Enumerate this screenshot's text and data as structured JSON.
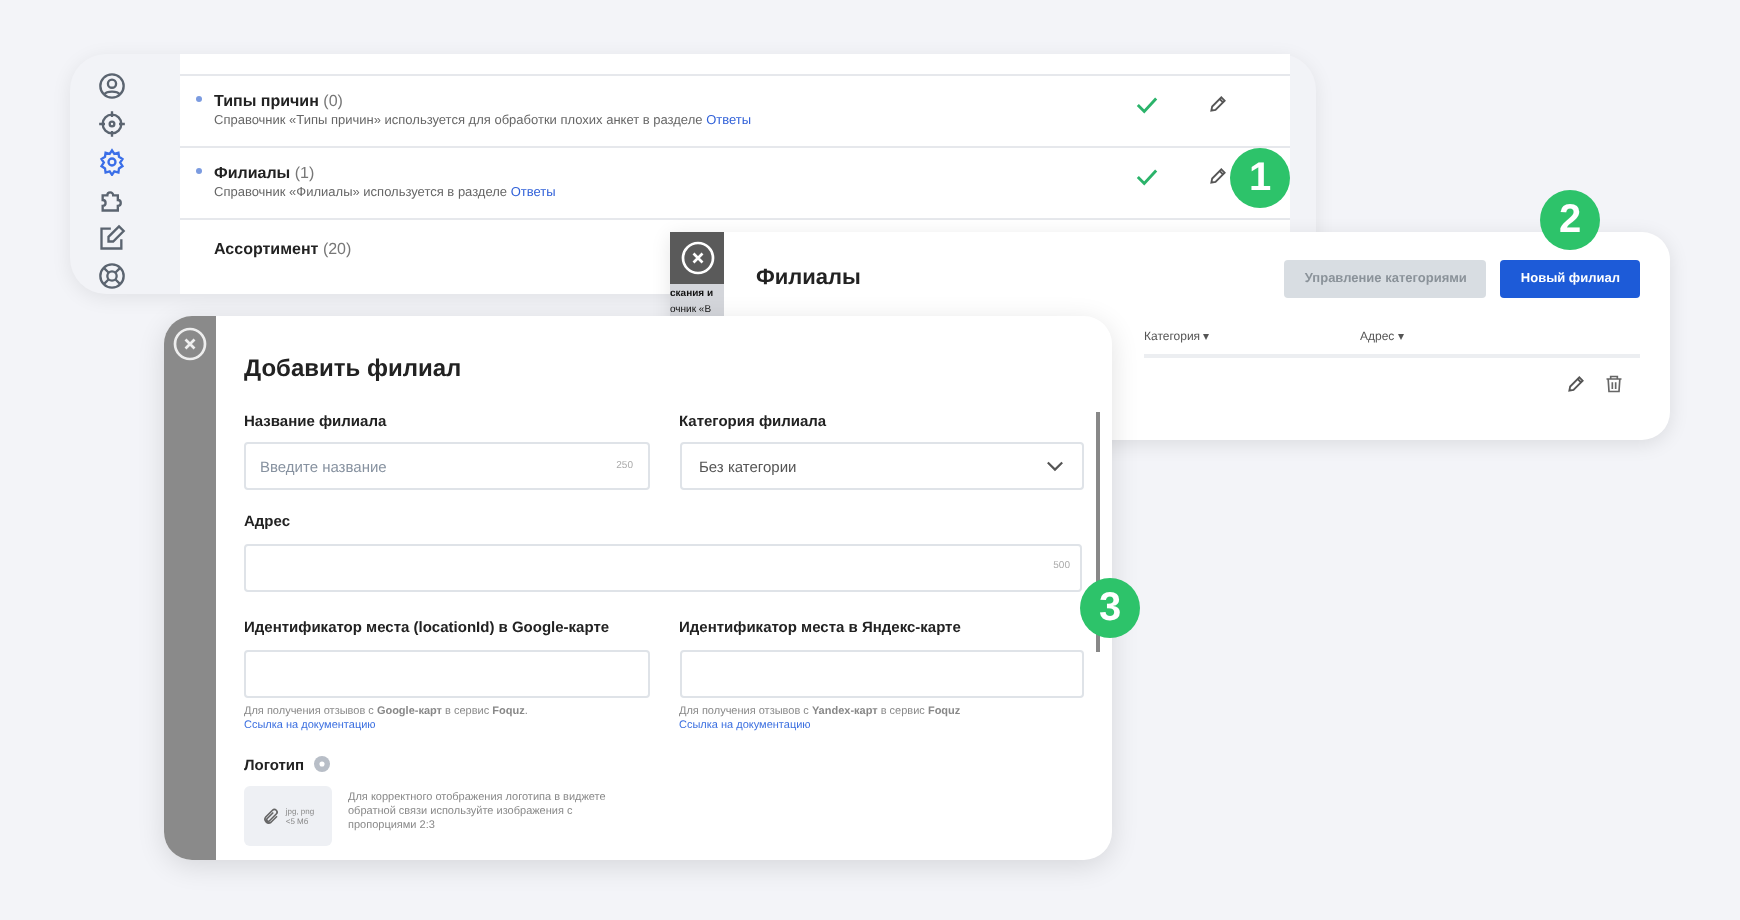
{
  "settings_panel": {
    "sidebar": [
      {
        "kind": "user",
        "selected": false
      },
      {
        "kind": "target",
        "selected": false
      },
      {
        "kind": "gear",
        "selected": true
      },
      {
        "kind": "puzzle",
        "selected": false
      },
      {
        "kind": "edit",
        "selected": false
      },
      {
        "kind": "help",
        "selected": false
      }
    ],
    "dictionaries": [
      {
        "title": "Типы причин",
        "count": "(0)",
        "description": "Справочник «Типы причин» используется для обработки плохих анкет в разделе",
        "link": "Ответы",
        "enabled": true
      },
      {
        "title": "Филиалы",
        "count": "(1)",
        "description": "Справочник «Филиалы» используется в разделе",
        "link": "Ответы",
        "enabled": true
      },
      {
        "title": "Ассортимент",
        "count": "(20)"
      }
    ]
  },
  "steps": [
    "1",
    "2",
    "3"
  ],
  "branches_panel": {
    "side_fragments": [
      "скания и",
      "очник «В"
    ],
    "title": "Филиалы",
    "buttons": [
      {
        "label": "Управление категориями",
        "disabled": true
      },
      {
        "label": "Новый филиал",
        "disabled": false
      }
    ],
    "columns": [
      "Категория ▾",
      "Адрес ▾"
    ]
  },
  "add_branch_dialog": {
    "title": "Добавить филиал",
    "name_field": {
      "label": "Название филиала",
      "placeholder": "Введите название",
      "counter": "250"
    },
    "category_field": {
      "label": "Категория филиала",
      "value": "Без категории"
    },
    "address_field": {
      "label": "Адрес",
      "counter": "500"
    },
    "google_field": {
      "label": "Идентификатор места (locationId) в Google-карте",
      "hint": "Для получения отзывов с **Google-карт** в сервис **Foquz**.",
      "link": "Ссылка на документацию"
    },
    "yandex_field": {
      "label": "Идентификатор места в Яндекс-карте",
      "hint": "Для получения отзывов с **Yandex-карт** в сервис **Foquz**",
      "link": "Ссылка на документацию"
    },
    "logo": {
      "label": "Логотип",
      "formats": "jpg, png",
      "size": "<5 Мб",
      "hint": "Для корректного отображения логотипа в виджете обратной связи используйте изображения с пропорциями 2:3"
    }
  }
}
